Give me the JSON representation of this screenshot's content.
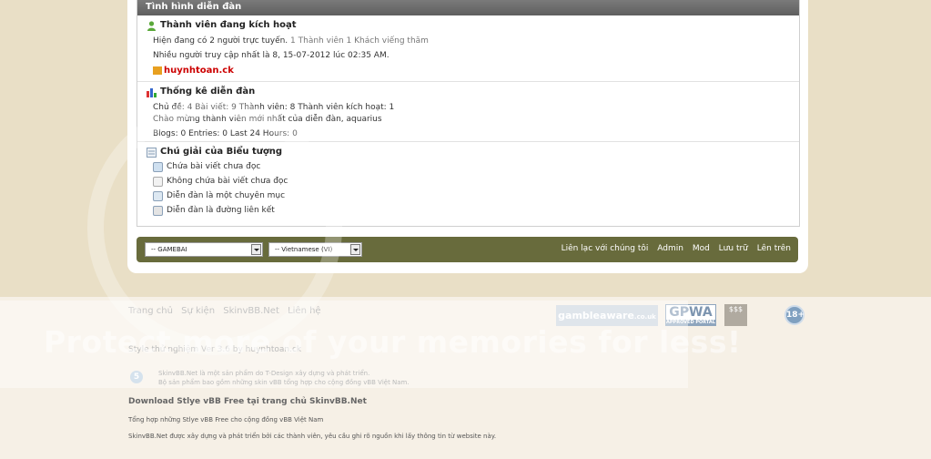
{
  "forum_status": {
    "header": "Tình hình diễn đàn",
    "online": {
      "title": "Thành viên đang kích hoạt",
      "line1": "Hiện đang có 2 người trực tuyến.",
      "line1_detail": "1 Thành viên 1 Khách viếng thăm",
      "line2": "Nhiều người truy cập nhất là 8, 15-07-2012 lúc 02:35 AM.",
      "user": "huynhtoan.ck"
    },
    "stats": {
      "title": "Thống kê diễn đàn",
      "line1": "Chủ đề: 4  Bài viết: 9  Thành viên: 8  Thành viên kích hoạt: 1",
      "line2": "Chào mừng thành viên mới nhất của diễn đàn, aquarius",
      "line3": "Blogs: 0  Entries: 0  Last 24 Hours: 0"
    },
    "legend": {
      "title": "Chú giải của Biểu tượng",
      "items": [
        {
          "label": "Chứa bài viết chưa đọc",
          "icon": "forum-new-icon"
        },
        {
          "label": "Không chứa bài viết chưa đọc",
          "icon": "forum-old-icon"
        },
        {
          "label": "Diễn đàn là một chuyên mục",
          "icon": "forum-category-icon"
        },
        {
          "label": "Diễn đàn là đường liên kết",
          "icon": "forum-link-icon"
        }
      ]
    }
  },
  "footer_bar": {
    "style_select": "-- GAMEBAI",
    "language_select": "-- Vietnamese (VI)",
    "links": [
      "Liên lạc với chúng tôi",
      "Admin",
      "Mod",
      "Lưu trữ",
      "Lên trên"
    ],
    "bar_color": "#686b3c"
  },
  "footer": {
    "nav": [
      "Trang chủ",
      "Sự kiện",
      "SkinvBB.Net",
      "Liên hệ"
    ],
    "badges": {
      "gamble": "gambleaware",
      "gamble_suffix": ".co.uk",
      "gpwa": "GPWA",
      "gpwa_sub": "APPROVED PORTAL",
      "casino": "$$$",
      "age": "18+"
    },
    "style_line": "Style thử nghiệm Ver 3.6 by huynhtoan.ck",
    "info_icon": "5",
    "info_line1": "SkinvBB.Net là một sản phẩm do T-Design xây dựng và phát triển.",
    "info_line2": "Bộ sản phẩm bao gồm những skin vBB tổng hợp cho cộng đồng vBB Việt Nam.",
    "download_title": "Download Stlye vBB Free tại trang chủ SkinvBB.Net",
    "line1": "Tổng hợp những Stlye vBB Free cho cộng đồng vBB Việt Nam",
    "line2": "SkinvBB.Net được xây dựng và phát triển bởi các thành viên, yêu cầu ghi rõ nguồn khi lấy thông tin từ website này."
  },
  "watermark": "Protect more of your memories for less!"
}
